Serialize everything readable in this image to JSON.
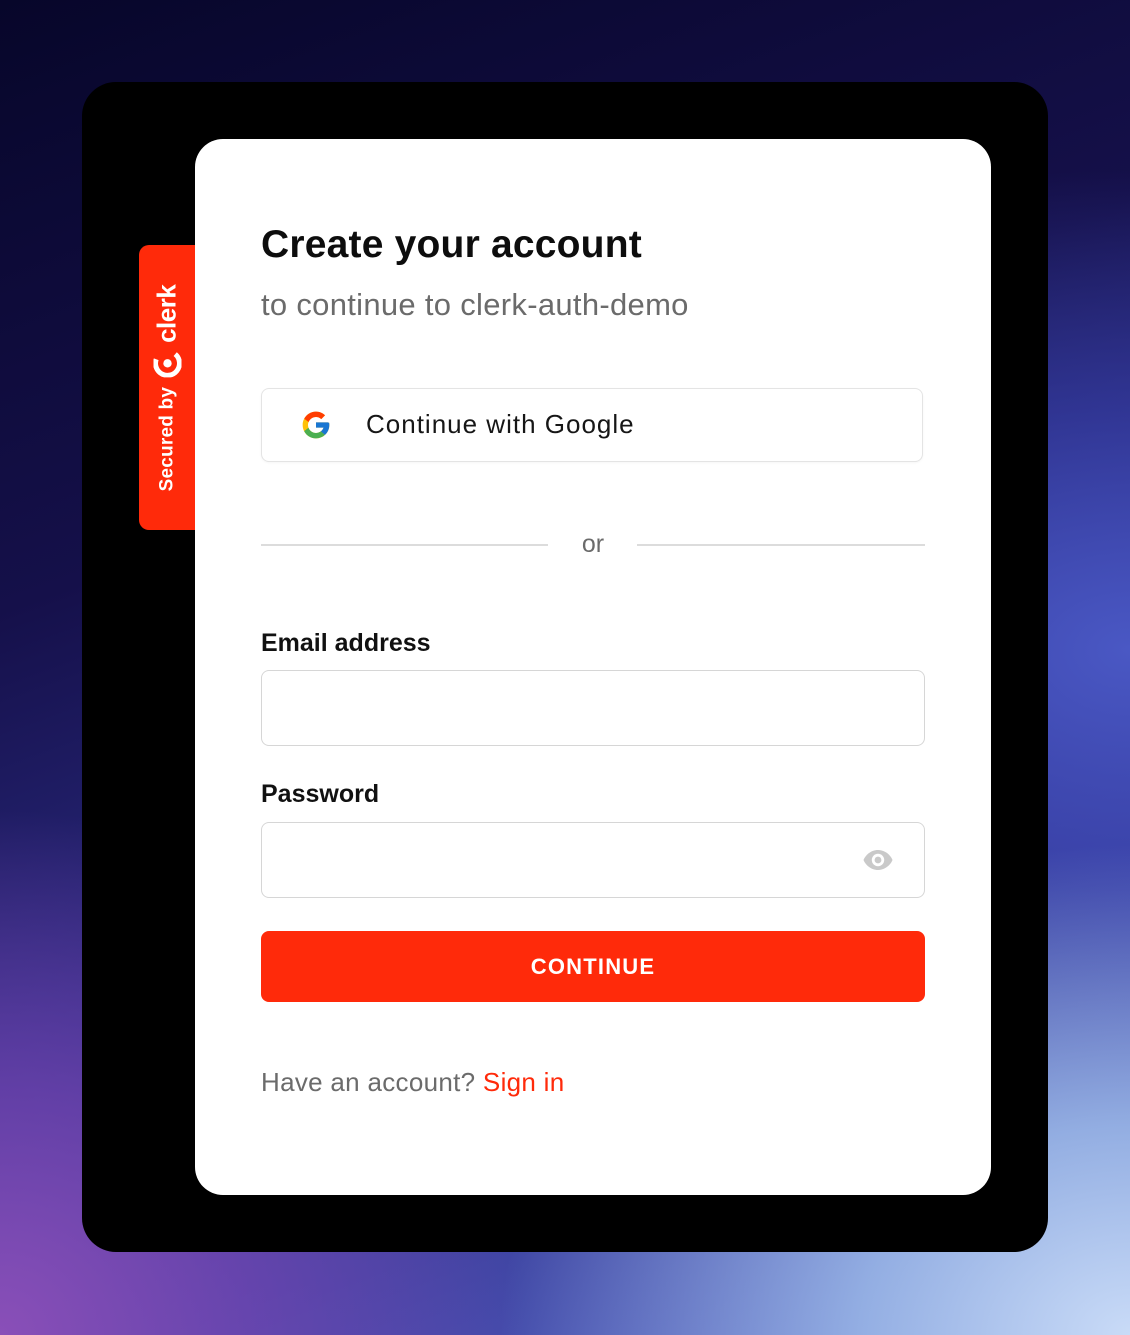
{
  "badge": {
    "secured_by": "Secured by",
    "brand": "clerk"
  },
  "card": {
    "title": "Create your account",
    "subtitle": "to continue to clerk-auth-demo"
  },
  "google_button": {
    "label": "Continue with Google",
    "icon": "google-g-icon"
  },
  "divider": {
    "text": "or"
  },
  "email": {
    "label": "Email address",
    "value": "",
    "placeholder": ""
  },
  "password": {
    "label": "Password",
    "value": "",
    "placeholder": "",
    "toggle_icon": "eye-icon"
  },
  "continue_button": {
    "label": "CONTINUE"
  },
  "footer": {
    "prompt": "Have an account?",
    "link": "Sign in"
  },
  "colors": {
    "accent": "#ff2a0a",
    "frame": "#000000",
    "card": "#ffffff",
    "muted_text": "#6b6b6b"
  }
}
